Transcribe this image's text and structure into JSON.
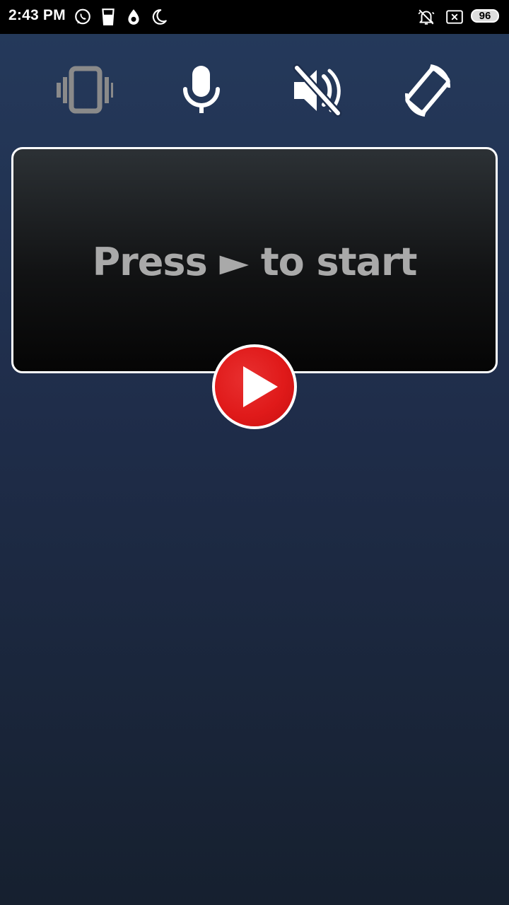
{
  "status_bar": {
    "time": "2:43 PM",
    "left_icons": [
      "whatsapp-icon",
      "drink-cup-icon",
      "egg-drop-icon",
      "moon-icon"
    ],
    "right_icons": [
      "alarm-off-icon",
      "no-sim-icon"
    ],
    "battery_level": "96"
  },
  "controls": [
    {
      "name": "vibrate",
      "icon": "vibrate-icon",
      "state": "disabled",
      "color": "#8a8a8a"
    },
    {
      "name": "microphone",
      "icon": "microphone-icon",
      "state": "enabled",
      "color": "#ffffff"
    },
    {
      "name": "sound",
      "icon": "volume-off-icon",
      "state": "muted",
      "color": "#ffffff"
    },
    {
      "name": "rotate",
      "icon": "screen-rotation-icon",
      "state": "enabled",
      "color": "#ffffff"
    }
  ],
  "prompt": {
    "text": "Press ► to start"
  },
  "play_button": {
    "icon": "play-icon",
    "color": "#e01a1a"
  }
}
